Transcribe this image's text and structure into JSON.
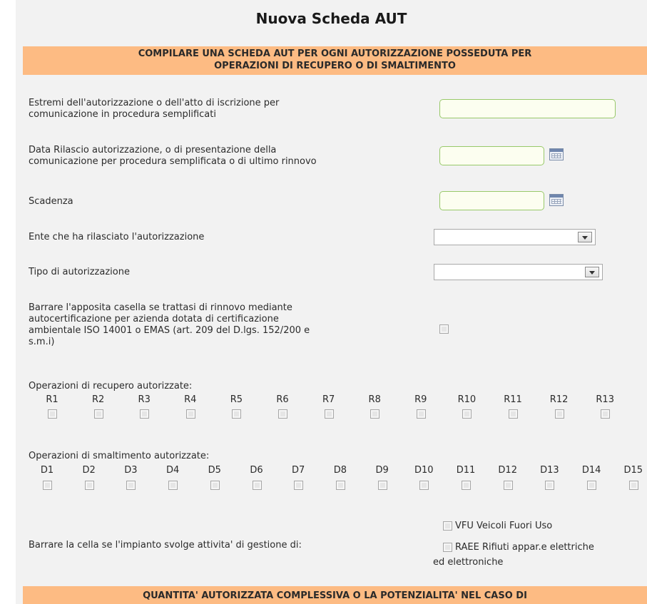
{
  "title": "Nuova Scheda AUT",
  "banner_top": {
    "line1": "COMPILARE UNA SCHEDA AUT PER OGNI AUTORIZZAZIONE POSSEDUTA PER",
    "line2": "OPERAZIONI DI RECUPERO O DI SMALTIMENTO"
  },
  "fields": {
    "estremi_label_l1": "Estremi dell'autorizzazione o dell'atto di iscrizione per",
    "estremi_label_l2": "comunicazione in procedura semplificati",
    "data_label_l1": "Data Rilascio autorizzazione, o di presentazione della",
    "data_label_l2": "comunicazione per procedura semplificata o di ultimo rinnovo",
    "scadenza_label": "Scadenza",
    "ente_label": "Ente che ha rilasciato l'autorizzazione",
    "tipo_label": "Tipo di autorizzazione",
    "rinnovo_l1": "Barrare l'apposita casella se trattasi di rinnovo mediante",
    "rinnovo_l2": "autocertificazione per azienda dotata di certificazione",
    "rinnovo_l3": "ambientale ISO 14001 o EMAS (art. 209 del D.lgs. 152/200 e",
    "rinnovo_l4": "s.m.i)"
  },
  "recupero": {
    "label": "Operazioni di recupero autorizzate:",
    "ops": [
      "R1",
      "R2",
      "R3",
      "R4",
      "R5",
      "R6",
      "R7",
      "R8",
      "R9",
      "R10",
      "R11",
      "R12",
      "R13"
    ]
  },
  "smaltimento": {
    "label": "Operazioni di smaltimento autorizzate:",
    "ops": [
      "D1",
      "D2",
      "D3",
      "D4",
      "D5",
      "D6",
      "D7",
      "D8",
      "D9",
      "D10",
      "D11",
      "D12",
      "D13",
      "D14",
      "D15"
    ]
  },
  "gestione": {
    "label": "Barrare la cella se l'impianto svolge attivita' di gestione di:",
    "vfu": "VFU Veicoli Fuori Uso",
    "raee_l1": "RAEE Rifiuti appar.e elettriche",
    "raee_l2": "ed elettroniche"
  },
  "banner_bottom": "QUANTITA' AUTORIZZATA COMPLESSIVA O LA POTENZIALITA' NEL CASO DI",
  "icons": {
    "calendar": "calendar-icon",
    "dropdown": "chevron-down-icon"
  },
  "colors": {
    "banner": "#fdbb83",
    "input_border": "#98c96a",
    "input_bg": "#fcfef0",
    "panel_bg": "#f2f2f2"
  }
}
